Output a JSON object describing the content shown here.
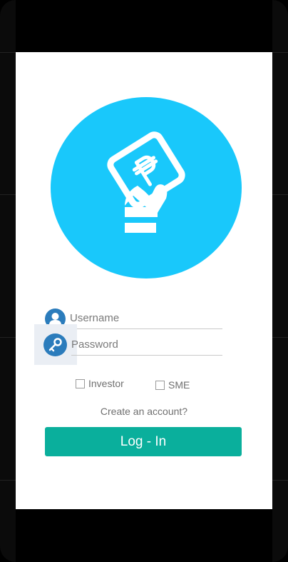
{
  "login": {
    "username_placeholder": "Username",
    "password_placeholder": "Password",
    "account_types": [
      {
        "label": "Investor",
        "checked": false
      },
      {
        "label": "SME",
        "checked": false
      }
    ],
    "create_account_link": "Create an account?",
    "login_button": "Log - In"
  },
  "colors": {
    "logo_circle": "#19c8fb",
    "icon_circle": "#2b7cbc",
    "login_button": "#0aaf9c",
    "field_underline": "#c9c9c9"
  },
  "icons": {
    "logo": "hand-holding-peso-tablet-icon",
    "username": "user-icon",
    "password": "key-icon"
  }
}
